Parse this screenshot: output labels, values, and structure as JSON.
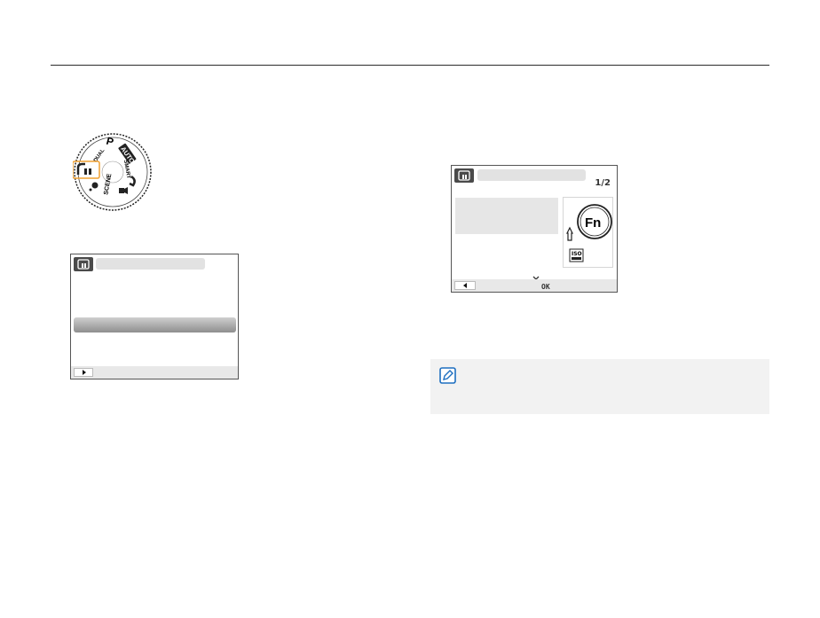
{
  "dial": {
    "mode_p": "P",
    "mode_auto": "AUTO",
    "mode_smart": "SMART",
    "mode_dual": "DUAL",
    "mode_scene": "SCENE",
    "highlight_color": "#f0a030",
    "icons": [
      "magic-frame-icon",
      "dual-is-icon",
      "smart-auto-icon",
      "movie-icon",
      "scene-icon",
      "night-icon"
    ]
  },
  "screen_left": {
    "mode_icon": "magic-frame-icon",
    "nav_icon": "play-arrow-icon"
  },
  "screen_right": {
    "mode_icon": "magic-frame-icon",
    "page_indicator": "1/2",
    "fn_label": "Fn",
    "ok_label": "OK",
    "iso_label": "ISO",
    "nav_icon": "back-arrow-icon"
  },
  "note": {
    "icon": "note-pencil-icon",
    "border_color": "#1e6fc0"
  }
}
